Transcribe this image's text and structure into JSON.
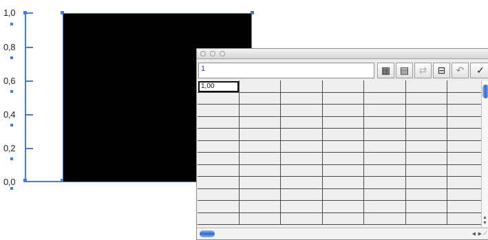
{
  "axis": {
    "ticks": [
      "1,0",
      "0,8",
      "0,6",
      "0,4",
      "0,2",
      "0,0"
    ]
  },
  "colors": {
    "selection": "#4a78d4",
    "bar_fill": "#000000"
  },
  "sheet": {
    "entry_value": "1",
    "active_cell_value": "1,00",
    "toolbar": [
      {
        "name": "import-data-icon",
        "glyph": "▦"
      },
      {
        "name": "transpose-icon",
        "glyph": "▤"
      },
      {
        "name": "switch-xy-icon",
        "glyph": "⇄"
      },
      {
        "name": "cell-style-icon",
        "glyph": "⊟"
      },
      {
        "name": "revert-icon",
        "glyph": "↶"
      },
      {
        "name": "apply-icon",
        "glyph": "✓"
      }
    ]
  }
}
